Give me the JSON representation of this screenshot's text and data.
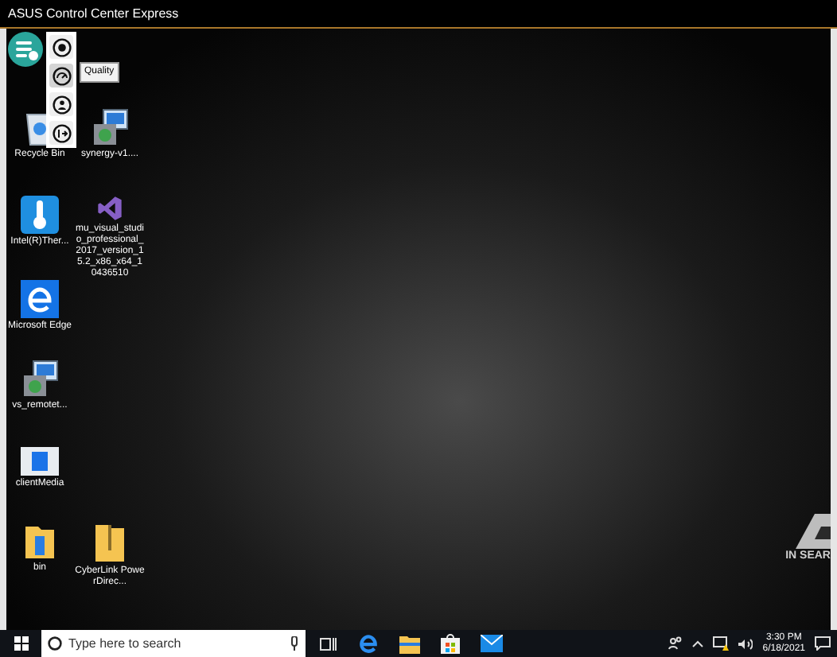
{
  "window": {
    "title": "ASUS Control Center Express"
  },
  "floating_menu": {
    "items": [
      {
        "kind": "settings",
        "selected": false
      },
      {
        "kind": "quality",
        "selected": true
      },
      {
        "kind": "user",
        "selected": false
      },
      {
        "kind": "exit",
        "selected": false
      }
    ],
    "tooltip": "Quality"
  },
  "desktop_icons": [
    {
      "label": "Recycle Bin",
      "kind": "recycle"
    },
    {
      "label": "Intel(R)Ther...",
      "kind": "thermometer"
    },
    {
      "label": "Microsoft Edge",
      "kind": "edge"
    },
    {
      "label": "vs_remotet...",
      "kind": "installer"
    },
    {
      "label": "clientMedia",
      "kind": "media"
    },
    {
      "label": "bin",
      "kind": "folder"
    },
    {
      "label": "synergy-v1....",
      "kind": "installer"
    },
    {
      "label": "mu_visual_studio_professional_2017_version_15.2_x86_x64_10436510",
      "kind": "vs"
    },
    {
      "label": "CyberLink PowerDirec...",
      "kind": "zip"
    }
  ],
  "wallpaper": {
    "tagline": "IN SEAR"
  },
  "taskbar": {
    "search": {
      "placeholder": "Type here to search"
    },
    "apps": [
      {
        "kind": "taskview"
      },
      {
        "kind": "edge"
      },
      {
        "kind": "explorer"
      },
      {
        "kind": "store"
      },
      {
        "kind": "mail"
      }
    ],
    "clock": {
      "time": "3:30 PM",
      "date": "6/18/2021"
    }
  }
}
